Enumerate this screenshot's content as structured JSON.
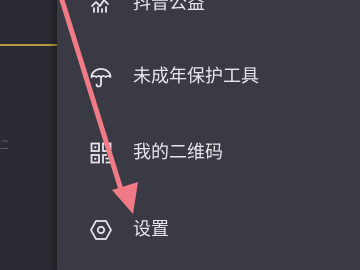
{
  "menu": {
    "items": [
      {
        "label": "抖音公益",
        "icon": "charity-heart-icon"
      },
      {
        "label": "未成年保护工具",
        "icon": "umbrella-icon"
      },
      {
        "label": "我的二维码",
        "icon": "qr-code-icon"
      },
      {
        "label": "设置",
        "icon": "settings-hexagon-icon"
      }
    ]
  },
  "background": {
    "edge_glyph": "二"
  },
  "colors": {
    "drawer_bg": "#393a44",
    "page_bg": "#2a2b33",
    "text": "#e6e6ea",
    "accent_line": "#b49a3a",
    "annotation_arrow": "#f07a86"
  }
}
